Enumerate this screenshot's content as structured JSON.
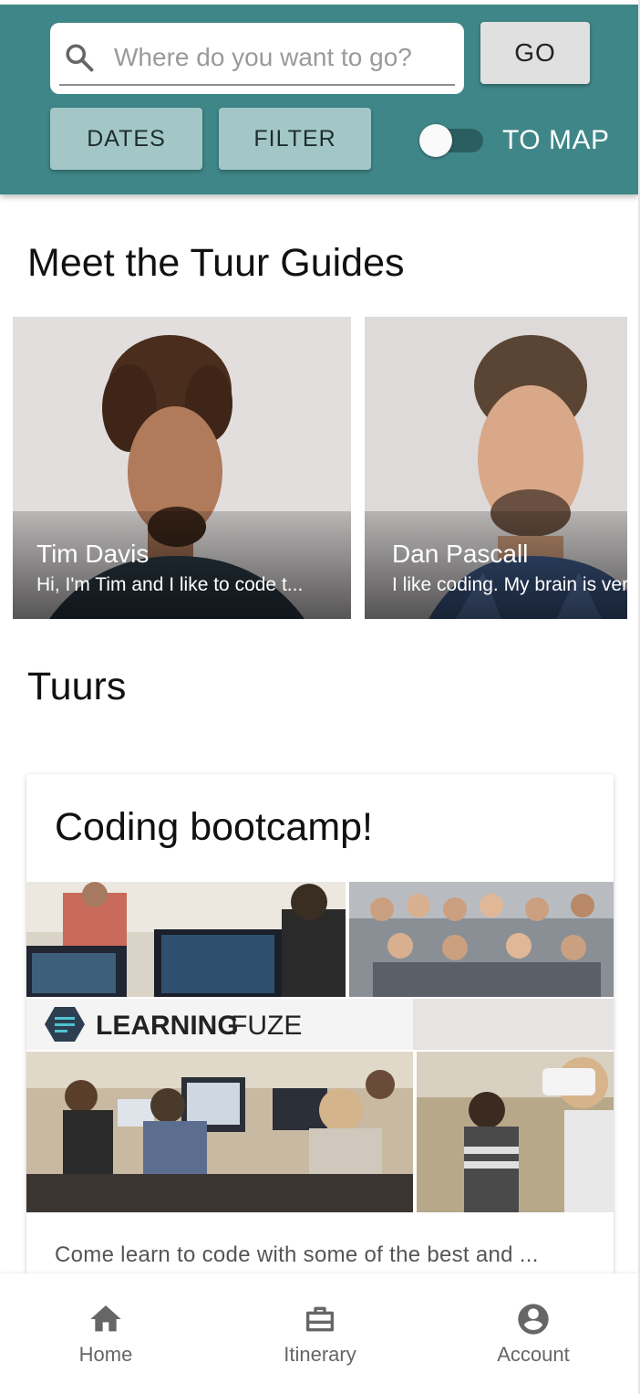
{
  "header": {
    "search": {
      "placeholder": "Where do you want to go?",
      "value": "",
      "icon": "search-icon"
    },
    "go_label": "GO",
    "dates_label": "DATES",
    "filter_label": "FILTER",
    "map_toggle": {
      "label": "TO MAP",
      "on": false
    }
  },
  "colors": {
    "header_bg": "#3f8688",
    "secondary_button": "#a2c7c6",
    "primary_button": "#e0e0e0"
  },
  "guides_section": {
    "title": "Meet the Tuur Guides",
    "guides": [
      {
        "name": "Tim Davis",
        "bio": "Hi, I'm Tim and I like to code t..."
      },
      {
        "name": "Dan Pascall",
        "bio": "I like coding. My brain is very"
      }
    ]
  },
  "tours_section": {
    "title": "Tuurs",
    "tours": [
      {
        "title": "Coding bootcamp!",
        "image_logo_text": {
          "bold": "LEARNING",
          "light": "FUZE"
        },
        "description": "Come learn to code with some of the best and ..."
      }
    ]
  },
  "bottom_nav": {
    "items": [
      {
        "label": "Home",
        "icon": "home-icon"
      },
      {
        "label": "Itinerary",
        "icon": "briefcase-icon"
      },
      {
        "label": "Account",
        "icon": "account-circle-icon"
      }
    ]
  }
}
